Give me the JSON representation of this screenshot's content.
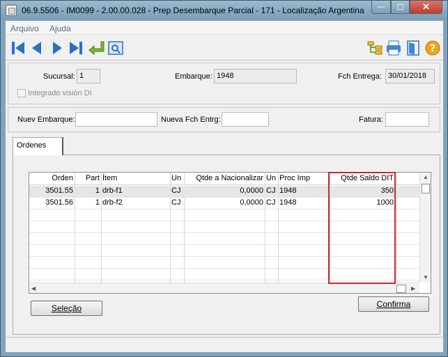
{
  "window": {
    "title": "06.9.5506 - IM0099 - 2.00.00.028 - Prep Desembarque Parcial - 171 - Localização Argentina",
    "min_glyph": "—",
    "max_glyph": "☐",
    "close_glyph": "✕"
  },
  "menu": {
    "items": [
      "Arquivo",
      "Ajuda"
    ]
  },
  "toolbar": {
    "icons": [
      "first-record-icon",
      "previous-record-icon",
      "next-record-icon",
      "last-record-icon",
      "return-icon",
      "zoom-icon",
      "structure-icon",
      "print-icon",
      "exit-icon",
      "help-icon"
    ]
  },
  "header": {
    "sucursal_label": "Sucursal:",
    "sucursal_value": "1",
    "embarque_label": "Embarque:",
    "embarque_value": "1948",
    "fch_entrega_label": "Fch Entrega:",
    "fch_entrega_value": "30/01/2018",
    "integrado_label": "Integrado visión DI"
  },
  "mid": {
    "nuev_embarque_label": "Nuev Embarque:",
    "nuev_embarque_value": "",
    "nueva_fch_label": "Nueva Fch Entrg:",
    "nueva_fch_value": "",
    "fatura_label": "Fatura:",
    "fatura_value": ""
  },
  "tabs": [
    {
      "label": "Ordenes"
    }
  ],
  "grid": {
    "columns": [
      "Orden",
      "Part",
      "Ítem",
      "Un",
      "Qtde a Nacionalizar",
      "Un",
      "Proc Imp",
      "Qtde Saldo DIT"
    ],
    "rows": [
      [
        "3501.55",
        "1",
        "drb-f1",
        "CJ",
        "0,0000",
        "CJ",
        "1948",
        "350"
      ],
      [
        "3501.56",
        "1",
        "drb-f2",
        "CJ",
        "0,0000",
        "CJ",
        "1948",
        "1000"
      ]
    ],
    "selected_row": 0
  },
  "buttons": {
    "selecao": "Seleção",
    "confirma": "Confirma"
  },
  "colors": {
    "highlight": "#c8282e",
    "titlebar": "#8fb0c7"
  }
}
